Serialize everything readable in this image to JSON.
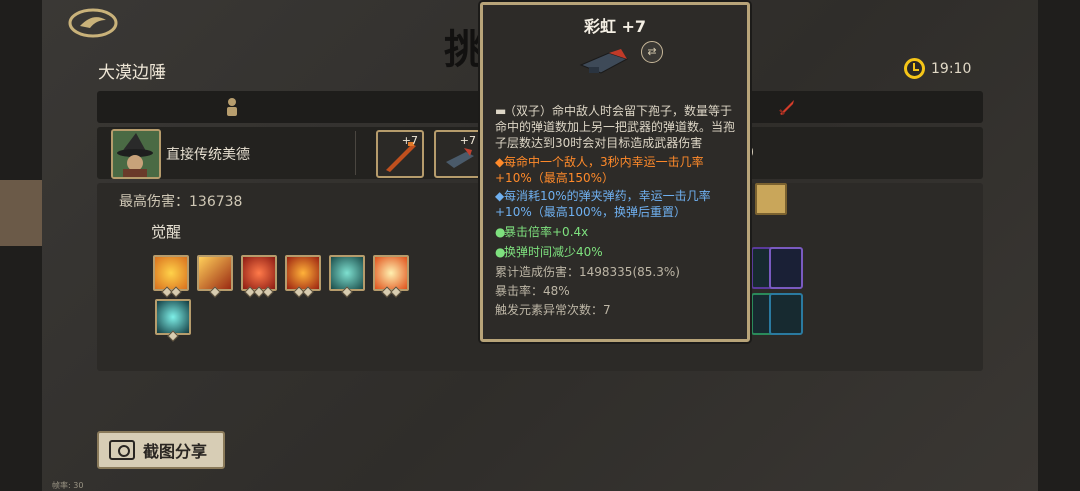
{
  "header": {
    "location": "大漠边陲",
    "page_title_glyph": "挑",
    "clock_time": "19:10"
  },
  "tabs": {
    "character_icon": "person-icon",
    "weapon_icon": "sword-icon"
  },
  "hero": {
    "name": "直接传统美德",
    "extra_value": "0",
    "weapons": [
      {
        "level": "+7"
      },
      {
        "level": "+7"
      }
    ]
  },
  "stats": {
    "max_damage": "最高伤害：136738",
    "awaken_label": "觉醒"
  },
  "share": {
    "label": "截图分享"
  },
  "fps": "帧率: 30",
  "tooltip": {
    "title": "彩虹 +7",
    "type_badge": "⇄",
    "description": "（双子）命中敌人时会留下孢子，数量等于命中的弹道数加上另一把武器的弹道数。当孢子层数达到30时会对目标造成武器伤害",
    "effect_orange": "每命中一个敌人，3秒内幸运一击几率+10%（最高150%）",
    "effect_blue": "每消耗10%的弹夹弹药，幸运一击几率+10%（最高100%，换弹后重置）",
    "effect_green_1": "暴击倍率+0.4x",
    "effect_green_2": "换弹时间减少40%",
    "stat_damage": "累计造成伤害：1498335(85.3%)",
    "stat_crit": "暴击率：48%",
    "stat_elemental": "触发元素异常次数：7"
  },
  "colors": {
    "accent_gold": "#b69c6c",
    "clock_yellow": "#f5c518",
    "orange": "#ff8a2a",
    "blue": "#6fb0f0",
    "green": "#7ee07e"
  }
}
